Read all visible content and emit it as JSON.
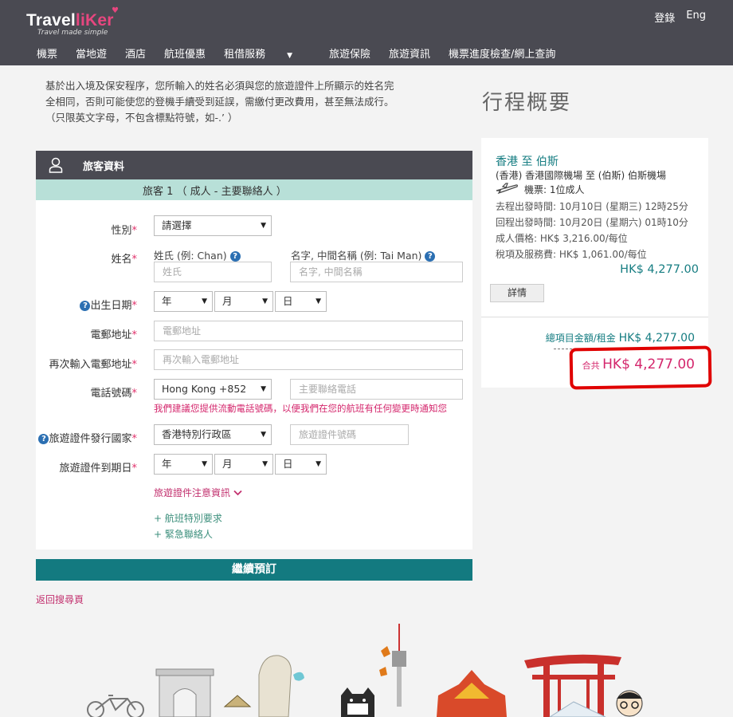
{
  "header": {
    "logo_a": "Travel",
    "logo_b": "liKer",
    "tagline": "Travel made simple",
    "login": "登錄",
    "language": "Eng",
    "nav": [
      "機票",
      "當地遊",
      "酒店",
      "航班優惠",
      "租借服務",
      "旅遊保險",
      "旅遊資訊",
      "機票進度檢查/網上查詢"
    ]
  },
  "notice": "基於出入境及保安程序，您所輸入的姓名必須與您的旅遊證件上所顯示的姓名完全相同，否則可能使您的登機手續受到延誤，需繳付更改費用，甚至無法成行。（只限英文字母，不包含標點符號，如-.’ ）",
  "form": {
    "panel_title": "旅客資料",
    "passenger_heading": "旅客 1 （ 成人 - 主要聯絡人 ）",
    "gender_label": "性別",
    "gender_value": "請選擇",
    "name_label": "姓名",
    "surname_label": "姓氏 (例: Chan)",
    "surname_placeholder": "姓氏",
    "given_label": "名字, 中間名稱 (例: Tai Man)",
    "given_placeholder": "名字, 中間名稱",
    "dob_label": "出生日期",
    "year": "年",
    "month": "月",
    "day": "日",
    "email_label": "電郵地址",
    "email_placeholder": "電郵地址",
    "email2_label": "再次輸入電郵地址",
    "email2_placeholder": "再次輸入電郵地址",
    "phone_label": "電話號碼",
    "phone_code": "Hong Kong +852",
    "phone_placeholder": "主要聯絡電話",
    "phone_hint": "我們建議您提供流動電話號碼，以便我們在您的航班有任何變更時通知您",
    "country_label": "旅遊證件發行國家",
    "country_value": "香港特別行政區",
    "doc_placeholder": "旅遊證件號碼",
    "expiry_label": "旅遊證件到期日",
    "doc_notes": "旅遊證件注意資訊",
    "special_request": "+ 航班特別要求",
    "emergency_contact": "+ 緊急聯絡人",
    "required_mark": "*",
    "help_mark": "?"
  },
  "continue_button": "繼續預訂",
  "back_link": "返回搜尋頁",
  "summary": {
    "title": "行程概要",
    "route": "香港 至 伯斯",
    "airports": "(香港) 香港國際機場 至 (伯斯) 伯斯機場",
    "ticket": "機票: 1位成人",
    "depart": "去程出發時間: 10月10日 (星期三) 12時25分",
    "return": "回程出發時間: 10月20日 (星期六) 01時10分",
    "adult_price": "成人價格: HK$ 3,216.00/每位",
    "taxes": "稅項及服務費: HK$ 1,061.00/每位",
    "price": "HK$ 4,277.00",
    "detail_button": "詳情",
    "subtotal_label": "總項目金額/租金",
    "subtotal_amount": "HK$ 4,277.00",
    "total_label": "合共",
    "total_amount": "HK$ 4,277.00"
  },
  "colors": {
    "header_bg": "#4a4a52",
    "brand_pink": "#e7467f",
    "teal": "#137a80",
    "mint": "#b8e0d8",
    "highlight_red": "#e00000"
  }
}
